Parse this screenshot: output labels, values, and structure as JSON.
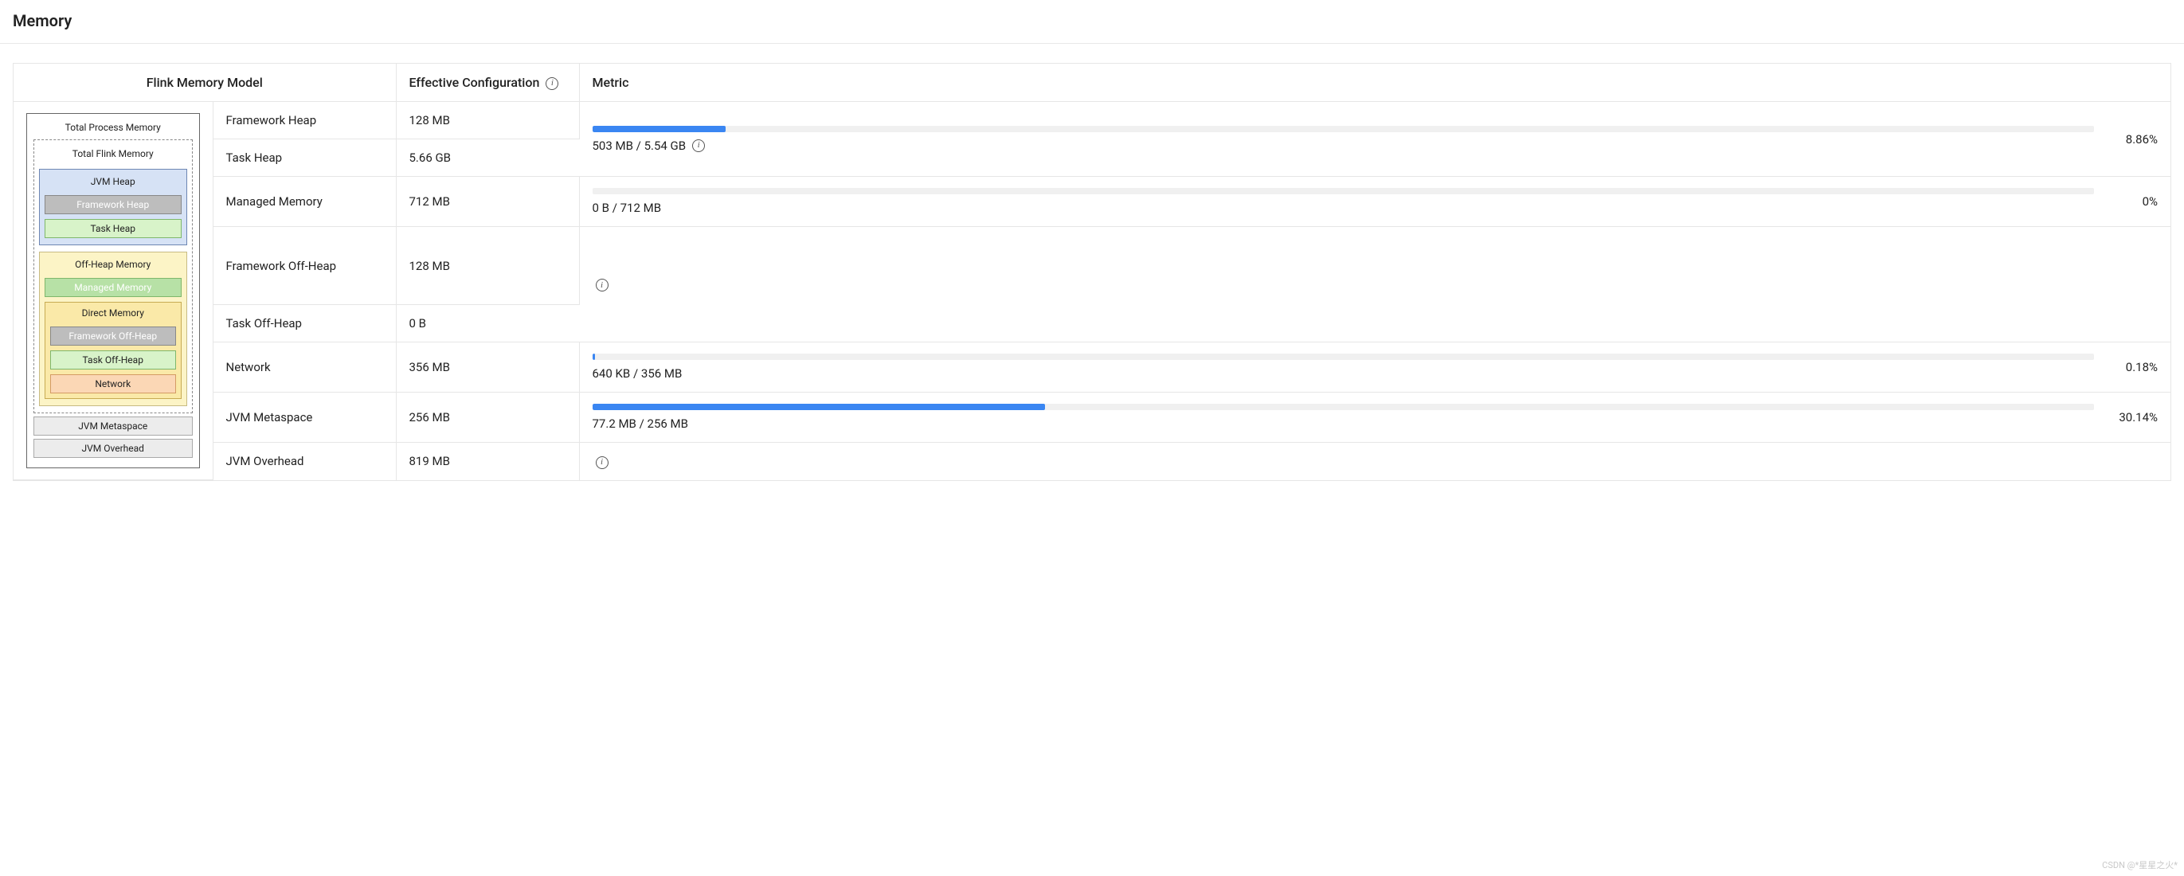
{
  "page": {
    "title": "Memory"
  },
  "headers": {
    "model": "Flink Memory Model",
    "config": "Effective Configuration",
    "metric": "Metric"
  },
  "diagram": {
    "total_process": "Total Process Memory",
    "total_flink": "Total Flink Memory",
    "jvm_heap": "JVM Heap",
    "framework_heap": "Framework Heap",
    "task_heap": "Task Heap",
    "off_heap": "Off-Heap Memory",
    "managed_memory": "Managed Memory",
    "direct_memory": "Direct Memory",
    "framework_off_heap": "Framework Off-Heap",
    "task_off_heap": "Task Off-Heap",
    "network": "Network",
    "jvm_metaspace": "JVM Metaspace",
    "jvm_overhead": "JVM Overhead"
  },
  "rows": {
    "framework_heap": {
      "label": "Framework Heap",
      "config": "128 MB"
    },
    "task_heap": {
      "label": "Task Heap",
      "config": "5.66 GB"
    },
    "heap_metric": {
      "text": "503 MB / 5.54 GB",
      "pct": "8.86%",
      "fill": 8.86
    },
    "managed": {
      "label": "Managed Memory",
      "config": "712 MB",
      "text": "0 B / 712 MB",
      "pct": "0%",
      "fill": 0
    },
    "framework_off": {
      "label": "Framework Off-Heap",
      "config": "128 MB"
    },
    "task_off": {
      "label": "Task Off-Heap",
      "config": "0 B"
    },
    "network": {
      "label": "Network",
      "config": "356 MB",
      "text": "640 KB / 356 MB",
      "pct": "0.18%",
      "fill": 0.18
    },
    "metaspace": {
      "label": "JVM Metaspace",
      "config": "256 MB",
      "text": "77.2 MB / 256 MB",
      "pct": "30.14%",
      "fill": 30.14
    },
    "overhead": {
      "label": "JVM Overhead",
      "config": "819 MB"
    }
  },
  "watermark": "CSDN @*星星之火*"
}
